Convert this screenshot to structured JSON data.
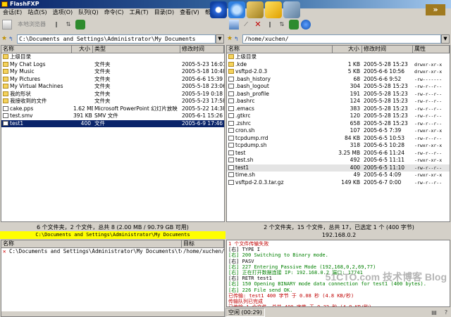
{
  "window": {
    "title": "FlashFXP"
  },
  "menu": [
    "会话(E)",
    "站点(S)",
    "选项(O)",
    "队列(Q)",
    "命令(C)",
    "工具(T)",
    "目录(D)",
    "查看(V)",
    "帮助(H)"
  ],
  "left_toolbar": {
    "connect_label": "本地浏览器"
  },
  "left_address": "C:\\Documents and Settings\\Administrator\\My Documents",
  "right_address": "/home/xuchen/",
  "columns_left": {
    "name": "名称",
    "size": "大小",
    "type": "类型",
    "modified": "修改时间"
  },
  "columns_right": {
    "name": "名称",
    "size": "大小",
    "modified": "修改时间",
    "attr": "属性"
  },
  "left_files": [
    {
      "name": "上级目录",
      "size": "",
      "type": "",
      "modified": "",
      "icon": "up"
    },
    {
      "name": "My Chat Logs",
      "size": "",
      "type": "文件夹",
      "modified": "2005-5-23 16:01",
      "icon": "folder"
    },
    {
      "name": "My Music",
      "size": "",
      "type": "文件夹",
      "modified": "2005-5-18 10:48",
      "icon": "folder"
    },
    {
      "name": "My Pictures",
      "size": "",
      "type": "文件夹",
      "modified": "2005-6-6 15:39",
      "icon": "folder"
    },
    {
      "name": "My Virtual Machines",
      "size": "",
      "type": "文件夹",
      "modified": "2005-5-18 23:06",
      "icon": "folder"
    },
    {
      "name": "我的形状",
      "size": "",
      "type": "文件夹",
      "modified": "2005-5-19 0:18",
      "icon": "folder"
    },
    {
      "name": "我接收到的文件",
      "size": "",
      "type": "文件夹",
      "modified": "2005-5-23 17:58",
      "icon": "folder"
    },
    {
      "name": "cake.pps",
      "size": "1.62 MB",
      "type": "Microsoft PowerPoint 幻灯片放映",
      "modified": "2005-5-22 14:38",
      "icon": "file"
    },
    {
      "name": "test.smv",
      "size": "391 KB",
      "type": "SMV 文件",
      "modified": "2005-6-1 15:26",
      "icon": "file"
    },
    {
      "name": "test1",
      "size": "400",
      "type": "文件",
      "modified": "2005-6-9 17:46",
      "icon": "file",
      "selected": true
    }
  ],
  "right_files": [
    {
      "name": "上级目录",
      "size": "",
      "modified": "",
      "attr": "",
      "icon": "up"
    },
    {
      "name": ".kde",
      "size": "1 KB",
      "modified": "2005-5-28 15:23",
      "attr": "drwxr-xr-x",
      "icon": "folder"
    },
    {
      "name": "vsftpd-2.0.3",
      "size": "5 KB",
      "modified": "2005-6-6 10:56",
      "attr": "drwxr-xr-x",
      "icon": "folder"
    },
    {
      "name": ".bash_history",
      "size": "68",
      "modified": "2005-6-6 9:52",
      "attr": "-rw-------",
      "icon": "file"
    },
    {
      "name": ".bash_logout",
      "size": "304",
      "modified": "2005-5-28 15:23",
      "attr": "-rw-r--r--",
      "icon": "file"
    },
    {
      "name": ".bash_profile",
      "size": "191",
      "modified": "2005-5-28 15:23",
      "attr": "-rw-r--r--",
      "icon": "file"
    },
    {
      "name": ".bashrc",
      "size": "124",
      "modified": "2005-5-28 15:23",
      "attr": "-rw-r--r--",
      "icon": "file"
    },
    {
      "name": ".emacs",
      "size": "383",
      "modified": "2005-5-28 15:23",
      "attr": "-rw-r--r--",
      "icon": "file"
    },
    {
      "name": ".gtkrc",
      "size": "120",
      "modified": "2005-5-28 15:23",
      "attr": "-rw-r--r--",
      "icon": "file"
    },
    {
      "name": ".zshrc",
      "size": "658",
      "modified": "2005-5-28 15:23",
      "attr": "-rw-r--r--",
      "icon": "file"
    },
    {
      "name": "cron.sh",
      "size": "107",
      "modified": "2005-6-5 7:39",
      "attr": "-rwxr-xr-x",
      "icon": "file"
    },
    {
      "name": "tcpdump.rrd",
      "size": "84 KB",
      "modified": "2005-6-5 10:53",
      "attr": "-rw-r--r--",
      "icon": "file"
    },
    {
      "name": "tcpdump.sh",
      "size": "318",
      "modified": "2005-6-5 10:28",
      "attr": "-rwxr-xr-x",
      "icon": "file"
    },
    {
      "name": "test",
      "size": "3.25 MB",
      "modified": "2005-6-6 11:24",
      "attr": "-rw-r--r--",
      "icon": "file"
    },
    {
      "name": "test.sh",
      "size": "492",
      "modified": "2005-6-5 11:11",
      "attr": "-rwxr-xr-x",
      "icon": "file"
    },
    {
      "name": "test1",
      "size": "400",
      "modified": "2005-6-5 11:10",
      "attr": "-rw-r--r--",
      "icon": "file",
      "highlight": true
    },
    {
      "name": "time.sh",
      "size": "49",
      "modified": "2005-6-5 4:09",
      "attr": "-rwxr-xr-x",
      "icon": "file"
    },
    {
      "name": "vsftpd-2.0.3.tar.gz",
      "size": "149 KB",
      "modified": "2005-6-7 0:00",
      "attr": "-rw-r--r--",
      "icon": "file"
    }
  ],
  "left_status": "6 个文件夹，2 个文件，总共 8 (2.00 MB / 90.79 GB 可用)",
  "left_path_status": "C:\\Documents and Settings\\Administrator\\My Documents",
  "right_status": "2 个文件夹，15 个文件，总共 17，已选定 1 个 (400 字节)",
  "right_ip": "192.168.0.2",
  "queue": {
    "columns": {
      "name": "名称",
      "target": "目标"
    },
    "items": [
      {
        "source": "C:\\Documents and Settings\\Administrator\\My Documents\\test.smv",
        "target": "/home/xuchen/te"
      }
    ]
  },
  "log": [
    {
      "text": "1 个文件传输失败",
      "color": "#c00000"
    },
    {
      "text": "[右] TYPE I",
      "color": "#000000"
    },
    {
      "text": "[右] 200 Switching to Binary mode.",
      "color": "#008000"
    },
    {
      "text": "[右] PASV",
      "color": "#000000"
    },
    {
      "text": "[右] 227 Entering Passive Mode (192,168,0,2,69,77)",
      "color": "#008000"
    },
    {
      "text": "[右] 正在打开数据连接 IP: 192.168.0.2 端口: 17741",
      "color": "#008000"
    },
    {
      "text": "[右] RETR test1",
      "color": "#000000"
    },
    {
      "text": "[右] 150 Opening BINARY mode data connection for test1 (400 bytes).",
      "color": "#008000"
    },
    {
      "text": "[右] 226 File send OK.",
      "color": "#008000"
    },
    {
      "text": "已传输: test1 400 字节 于 0.08 秒 (4.8 KB/秒)",
      "color": "#c00000"
    },
    {
      "text": "传输队列已完成",
      "color": "#c00000"
    },
    {
      "text": "已传输 1 个文件，总共 400 字节 于 0.32 秒 (4.8 KB/秒)",
      "color": "#c00000"
    }
  ],
  "bottom_status": "空闲 (00:29)",
  "watermark": "51CTO.com 技术博客 Blog"
}
